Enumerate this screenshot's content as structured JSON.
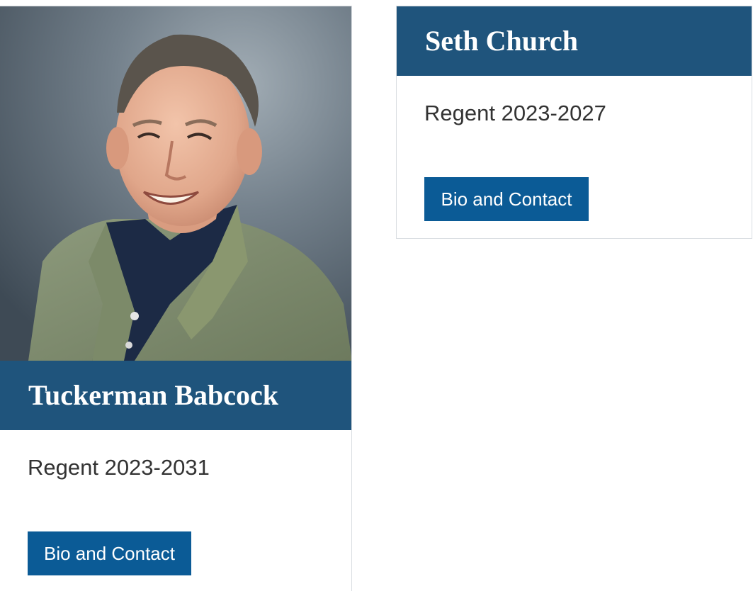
{
  "colors": {
    "name_bar": "#1f547c",
    "button": "#0b5b96",
    "term_text": "#333333",
    "card_border": "#d9dde1"
  },
  "regents": [
    {
      "name": "Tuckerman Babcock",
      "term": "Regent 2023-2031",
      "button_label": "Bio and Contact",
      "has_photo": true
    },
    {
      "name": "Seth Church",
      "term": "Regent 2023-2027",
      "button_label": "Bio and Contact",
      "has_photo": false
    }
  ]
}
